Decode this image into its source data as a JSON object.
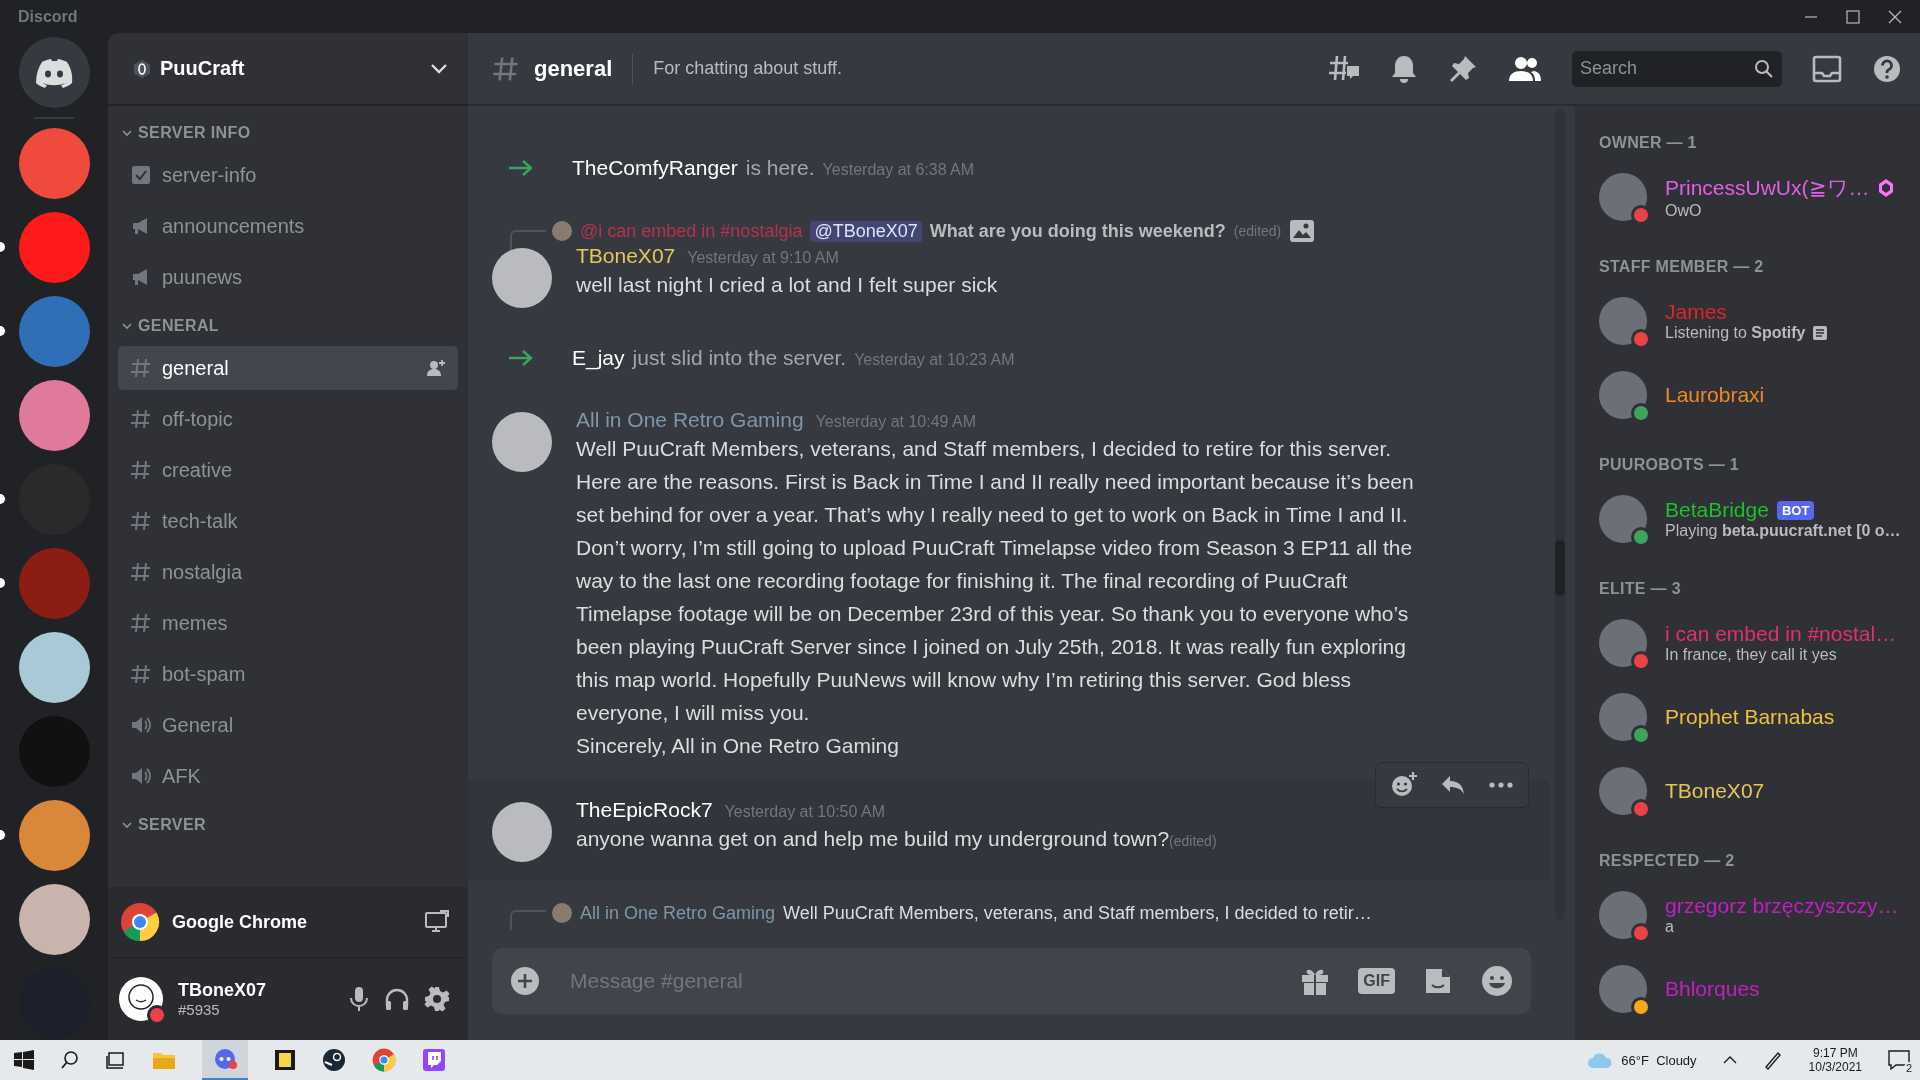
{
  "window": {
    "title": "Discord"
  },
  "servers": [
    {
      "color": "#f04a3c",
      "unread": false
    },
    {
      "color": "#ff1a1a",
      "unread": true
    },
    {
      "color": "#2f6fb5",
      "unread": true
    },
    {
      "color": "#e07a9a",
      "unread": false
    },
    {
      "color": "#2a2a2a",
      "unread": true
    },
    {
      "color": "#8c1d12",
      "unread": true
    },
    {
      "color": "#a9c9d6",
      "unread": false
    },
    {
      "color": "#111111",
      "unread": false
    },
    {
      "color": "#d9883a",
      "unread": true
    },
    {
      "color": "#c9b3ad",
      "unread": false
    },
    {
      "color": "#1d1f2a",
      "unread": false
    }
  ],
  "server": {
    "name": "PuuCraft"
  },
  "categories": [
    {
      "name": "SERVER INFO",
      "channels": [
        {
          "name": "server-info",
          "kind": "rules",
          "selected": false
        },
        {
          "name": "announcements",
          "kind": "news",
          "selected": false
        },
        {
          "name": "puunews",
          "kind": "news",
          "selected": false
        }
      ]
    },
    {
      "name": "GENERAL",
      "channels": [
        {
          "name": "general",
          "kind": "text",
          "selected": true
        },
        {
          "name": "off-topic",
          "kind": "text",
          "selected": false
        },
        {
          "name": "creative",
          "kind": "text",
          "selected": false
        },
        {
          "name": "tech-talk",
          "kind": "text",
          "selected": false
        },
        {
          "name": "nostalgia",
          "kind": "text",
          "selected": false
        },
        {
          "name": "memes",
          "kind": "text",
          "selected": false
        },
        {
          "name": "bot-spam",
          "kind": "text",
          "selected": false
        },
        {
          "name": "General",
          "kind": "voice",
          "selected": false
        },
        {
          "name": "AFK",
          "kind": "voice",
          "selected": false
        }
      ]
    },
    {
      "name": "SERVER"
    }
  ],
  "activity": {
    "name": "Google Chrome"
  },
  "user": {
    "name": "TBoneX07",
    "tag": "#5935",
    "status": {
      "color": "#ed4245"
    }
  },
  "channel_header": {
    "name": "general",
    "topic": "For chatting about stuff.",
    "search": {
      "placeholder": "Search"
    }
  },
  "messages": [
    {
      "kind": "join",
      "author": "TheComfyRanger",
      "text": "is here.",
      "time": "Yesterday at 6:38 AM"
    },
    {
      "kind": "message",
      "author": "TBoneX07",
      "color": "#e8c55a",
      "time": "Yesterday at 9:10 AM",
      "hovered": false,
      "reply": {
        "author": "@i can embed in #nostalgia",
        "mention": "@TBoneX07",
        "text": "What are you doing this weekend?",
        "edited": "(edited)"
      },
      "paragraphs": [
        "well last night I cried a lot and I felt super sick"
      ]
    },
    {
      "kind": "join",
      "author": "E_jay",
      "text": "just slid into the server.",
      "time": "Yesterday at 10:23 AM"
    },
    {
      "kind": "message",
      "author": "All in One Retro Gaming",
      "color": "#7f95a8",
      "time": "Yesterday at 10:49 AM",
      "hovered": false,
      "paragraphs": [
        "Well PuuCraft Members, veterans, and Staff members, I decided to retire for this server. Here are the reasons. First is Back in Time I and II really need important because it’s been set behind for over a year. That’s why I really need to get to work on Back in Time I and II. Don’t worry, I’m still going to upload PuuCraft Timelapse video from Season 3 EP11 all the way to the last one recording footage for finishing it. The final recording of PuuCraft Timelapse footage will be on December 23rd of this year. So thank you to everyone who’s been playing PuuCraft Server since I joined on July 25th, 2018. It was really fun exploring this map world. Hopefully PuuNews will know why I’m retiring this server. God bless everyone, I will miss you.",
        "Sincerely, All in One Retro Gaming"
      ]
    },
    {
      "kind": "message",
      "author": "TheEpicRock7",
      "color": "#ffffff",
      "time": "Yesterday at 10:50 AM",
      "hovered": true,
      "paragraphs": [
        "anyone wanna get on and help me build my underground town?"
      ],
      "edited": "(edited)"
    },
    {
      "kind": "reply_stub",
      "author": "All in One Retro Gaming",
      "color": "#7f95a8",
      "text": "Well PuuCraft Members, veterans, and Staff members, I decided to retir…"
    }
  ],
  "composer": {
    "placeholder": "Message #general",
    "gif_label": "GIF"
  },
  "member_groups": [
    {
      "title": "OWNER — 1",
      "members": [
        {
          "name": "PrincessUwUx(≧ワ…",
          "color": "#e35ee3",
          "status": {
            "color": "#ed4245"
          },
          "activity": "OwO",
          "activity_icon": false,
          "booster": true,
          "bot": false
        }
      ]
    },
    {
      "title": "STAFF MEMBER — 2",
      "members": [
        {
          "name": "James",
          "color": "#e02424",
          "status": {
            "color": "#ed4245"
          },
          "activity": "Listening to **Spotify**",
          "activity_icon": true,
          "booster": false,
          "bot": false
        },
        {
          "name": "Laurobraxi",
          "color": "#ee8a24",
          "status": {
            "color": "#3ba55d"
          },
          "activity_icon": false,
          "booster": false,
          "bot": false
        }
      ]
    },
    {
      "title": "PUUROBOTS — 1",
      "members": [
        {
          "name": "BetaBridge",
          "color": "#1fbf2a",
          "status": {
            "color": "#3ba55d"
          },
          "activity_icon": false,
          "activity": "Playing **beta.puucraft.net [0 o…**",
          "booster": false,
          "bot": true,
          "bot_label": "BOT"
        }
      ]
    },
    {
      "title": "ELITE — 3",
      "members": [
        {
          "name": "i can embed in #nostal…",
          "color": "#e0306e",
          "status": {
            "color": "#ed4245"
          },
          "activity_icon": false,
          "activity": "In france, they call it yes",
          "booster": false,
          "bot": false
        },
        {
          "name": "Prophet Barnabas",
          "color": "#f0c03c",
          "status": {
            "color": "#3ba55d"
          },
          "activity_icon": false,
          "booster": false,
          "bot": false
        },
        {
          "name": "TBoneX07",
          "color": "#e8c55a",
          "status": {
            "color": "#ed4245"
          },
          "activity_icon": false,
          "booster": false,
          "bot": false
        }
      ]
    },
    {
      "title": "RESPECTED — 2",
      "members": [
        {
          "name": "grzegorz brzęczyszczy…",
          "color": "#c21fc2",
          "status": {
            "color": "#ed4245"
          },
          "activity_icon": false,
          "activity": "a",
          "booster": false,
          "bot": false
        },
        {
          "name": "Bhlorques",
          "color": "#c21fc2",
          "status": {
            "color": "#faa81a"
          },
          "activity_icon": false,
          "booster": false,
          "bot": false
        }
      ]
    }
  ],
  "taskbar": {
    "weather": "66°F  Cloudy",
    "time": "9:17 PM",
    "date": "10/3/2021",
    "notifications": "2"
  }
}
